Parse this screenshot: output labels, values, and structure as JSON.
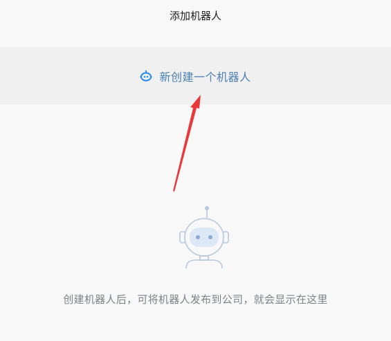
{
  "header": {
    "title": "添加机器人"
  },
  "create": {
    "icon": "robot-icon",
    "label": "新创建一个机器人"
  },
  "empty_state": {
    "icon": "robot-illustration-icon",
    "message": "创建机器人后，可将机器人发布到公司，就会显示在这里"
  },
  "colors": {
    "accent": "#4a7fb3",
    "icon_blue": "#2a8be8",
    "arrow_red": "#e8383a"
  }
}
